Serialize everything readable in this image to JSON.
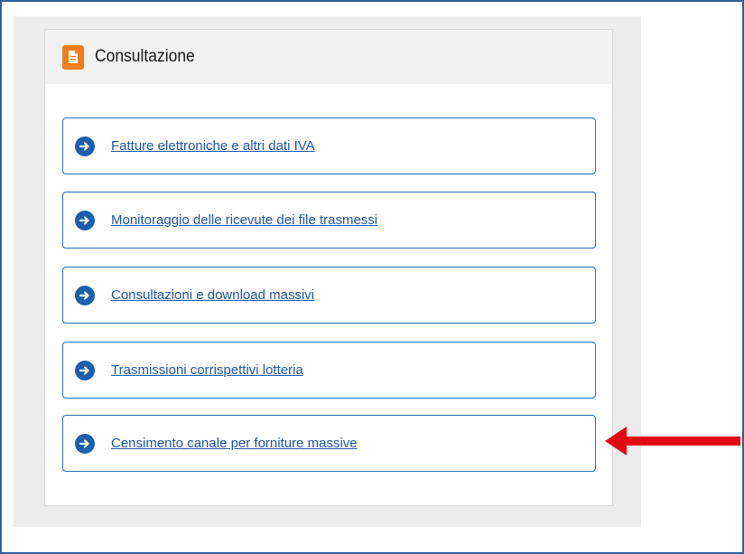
{
  "panel": {
    "title": "Consultazione",
    "header_icon": "document-icon",
    "header_icon_color": "#f07d1e"
  },
  "links": [
    {
      "label": "Fatture elettroniche e altri dati IVA",
      "icon": "arrow-right-circle-icon"
    },
    {
      "label": "Monitoraggio delle ricevute dei file trasmessi",
      "icon": "arrow-right-circle-icon"
    },
    {
      "label": "Consultazioni e download massivi",
      "icon": "arrow-right-circle-icon"
    },
    {
      "label": "Trasmissioni corrispettivi lotteria",
      "icon": "arrow-right-circle-icon"
    },
    {
      "label": "Censimento canale per forniture massive",
      "icon": "arrow-right-circle-icon"
    }
  ],
  "annotation": {
    "icon": "red-arrow-pointer-icon",
    "color": "#e30613",
    "points_to": "Censimento canale per forniture massive"
  },
  "colors": {
    "link": "#1f56a6",
    "border": "#2b6cb0",
    "frame": "#2f5d9b"
  }
}
